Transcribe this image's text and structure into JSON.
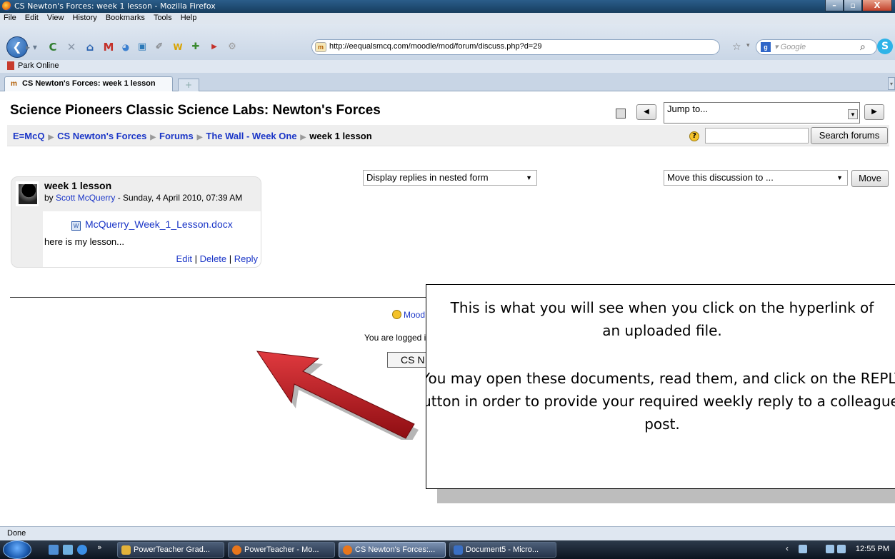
{
  "window": {
    "title": "CS Newton's Forces: week 1 lesson - Mozilla Firefox",
    "buttons": [
      "–",
      "▫",
      "X"
    ]
  },
  "menu": [
    "File",
    "Edit",
    "View",
    "History",
    "Bookmarks",
    "Tools",
    "Help"
  ],
  "navigation": {
    "url": "http://eequalsmcq.com/moodle/mod/forum/discuss.php?d=29",
    "search_placeholder": "Google"
  },
  "bookmarks": [
    "Park Online"
  ],
  "tabs": [
    {
      "label": "CS Newton's Forces: week 1 lesson"
    }
  ],
  "moodle": {
    "course_title": "Science Pioneers Classic Science Labs: Newton's Forces",
    "jump_to": "Jump to...",
    "breadcrumb": [
      {
        "label": "E=McQ",
        "link": true
      },
      {
        "label": "CS Newton's Forces",
        "link": true
      },
      {
        "label": "Forums",
        "link": true
      },
      {
        "label": "The Wall - Week One",
        "link": true
      },
      {
        "label": "week 1 lesson",
        "link": false
      }
    ],
    "search_button": "Search forums",
    "display_mode": "Display replies in nested form",
    "move_select": "Move this discussion to ...",
    "move_button": "Move",
    "post": {
      "subject": "week 1 lesson",
      "by": "by",
      "author": "Scott McQuerry",
      "date": " - Sunday, 4 April 2010, 07:39 AM",
      "attachment": "McQuerry_Week_1_Lesson.docx",
      "message": "here is my lesson...",
      "commands": [
        "Edit",
        "Delete",
        "Reply"
      ]
    },
    "footer": {
      "help_link": "Mood",
      "logged_in": "You are logged i",
      "course_button": "CS N"
    }
  },
  "callout": {
    "text1": "This is what you will see when you click on the hyperlink of an uploaded file.",
    "text2": "You may open these documents, read them, and click on the REPLY button in order to provide your required weekly reply to a colleague’s post.",
    "arrow_color": "#c0141b"
  },
  "status": "Done",
  "taskbar": {
    "items": [
      {
        "label": "PowerTeacher Grad...",
        "icon": "gradebook-icon",
        "active": false
      },
      {
        "label": "PowerTeacher - Mo...",
        "icon": "firefox-icon",
        "active": false
      },
      {
        "label": "CS Newton's Forces:...",
        "icon": "firefox-icon",
        "active": true
      },
      {
        "label": "Document5 - Micro...",
        "icon": "word-icon",
        "active": false
      }
    ],
    "clock": "12:55 PM"
  }
}
